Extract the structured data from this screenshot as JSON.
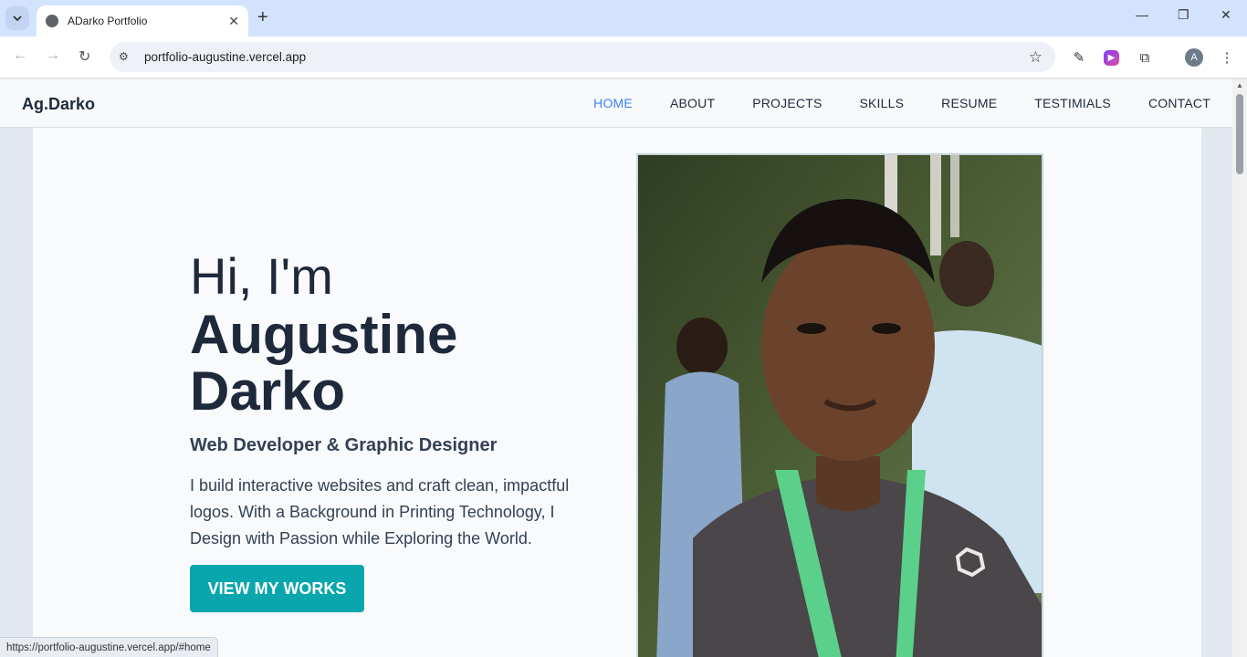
{
  "browser": {
    "tab_title": "ADarko Portfolio",
    "url": "portfolio-augustine.vercel.app",
    "profile_initial": "A",
    "status_url": "https://portfolio-augustine.vercel.app/#home"
  },
  "site": {
    "brand": "Ag.Darko",
    "nav": [
      {
        "label": "HOME",
        "active": true
      },
      {
        "label": "ABOUT",
        "active": false
      },
      {
        "label": "PROJECTS",
        "active": false
      },
      {
        "label": "SKILLS",
        "active": false
      },
      {
        "label": "RESUME",
        "active": false
      },
      {
        "label": "TESTIMIALS",
        "active": false
      },
      {
        "label": "CONTACT",
        "active": false
      }
    ]
  },
  "hero": {
    "greeting": "Hi, I'm",
    "name": "Augustine Darko",
    "role": "Web Developer & Graphic Designer",
    "bio": "I build interactive websites and craft clean, impactful logos. With a Background in Printing Technology, I Design with Passion while Exploring the World.",
    "cta_label": "VIEW MY WORKS"
  },
  "colors": {
    "accent": "#0aa6ad",
    "nav_active": "#3b82f6",
    "text_dark": "#1e293b"
  }
}
